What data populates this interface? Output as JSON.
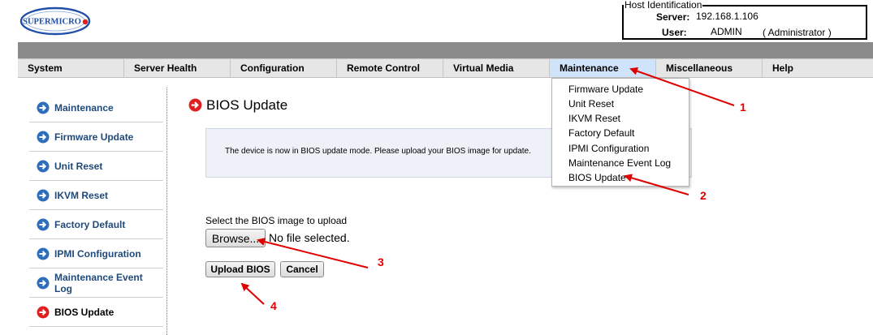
{
  "logo": {
    "text": "SUPERMICRO"
  },
  "host": {
    "legend": "Host Identification",
    "server_label": "Server:",
    "server_value": "192.168.1.106",
    "user_label": "User:",
    "user_value": "ADMIN",
    "user_role": "( Administrator )"
  },
  "nav": {
    "items": [
      {
        "label": "System"
      },
      {
        "label": "Server Health"
      },
      {
        "label": "Configuration"
      },
      {
        "label": "Remote Control"
      },
      {
        "label": "Virtual Media"
      },
      {
        "label": "Maintenance"
      },
      {
        "label": "Miscellaneous"
      },
      {
        "label": "Help"
      }
    ],
    "active": "Maintenance"
  },
  "dropdown": {
    "items": [
      {
        "label": "Firmware Update"
      },
      {
        "label": "Unit Reset"
      },
      {
        "label": "IKVM Reset"
      },
      {
        "label": "Factory Default"
      },
      {
        "label": "IPMI Configuration"
      },
      {
        "label": "Maintenance Event Log"
      },
      {
        "label": "BIOS Update"
      }
    ]
  },
  "sidebar": {
    "items": [
      {
        "label": "Maintenance"
      },
      {
        "label": "Firmware Update"
      },
      {
        "label": "Unit Reset"
      },
      {
        "label": "IKVM Reset"
      },
      {
        "label": "Factory Default"
      },
      {
        "label": "IPMI Configuration"
      },
      {
        "label": "Maintenance Event Log"
      },
      {
        "label": "BIOS Update"
      }
    ],
    "active": "BIOS Update"
  },
  "main": {
    "title": "BIOS Update",
    "info_text": "The device is now in BIOS update mode. Please upload your BIOS image for update.",
    "select_label": "Select the BIOS image to upload",
    "browse_label": "Browse...",
    "file_status": "No file selected.",
    "upload_label": "Upload BIOS",
    "cancel_label": "Cancel"
  },
  "annotations": [
    "1",
    "2",
    "3",
    "4"
  ],
  "colors": {
    "brand_blue": "#1f4fa8",
    "brand_red": "#e0201b",
    "nav_active": "#cfe4fa",
    "link_blue": "#1f4a7a",
    "annotation_red": "#e00000"
  }
}
